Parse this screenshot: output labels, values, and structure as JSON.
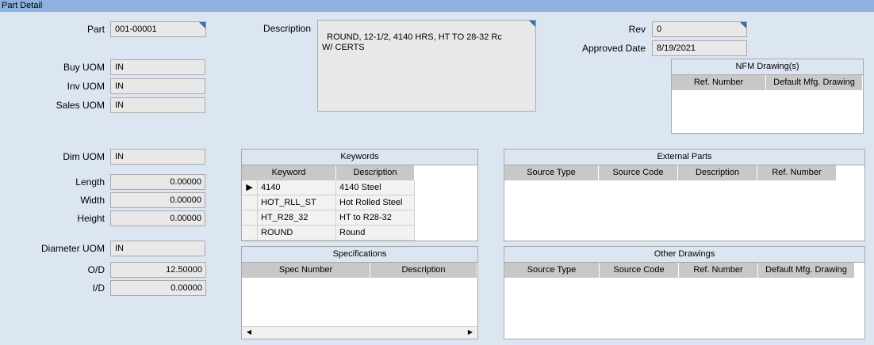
{
  "window": {
    "title": "Part Detail"
  },
  "part": {
    "label": "Part",
    "value": "001-00001"
  },
  "uom": {
    "buy_label": "Buy UOM",
    "buy_value": "IN",
    "inv_label": "Inv UOM",
    "inv_value": "IN",
    "sales_label": "Sales UOM",
    "sales_value": "IN"
  },
  "description": {
    "label": "Description",
    "value": "ROUND, 12-1/2, 4140 HRS, HT TO 28-32 Rc\nW/ CERTS"
  },
  "rev": {
    "label": "Rev",
    "value": "0"
  },
  "approved": {
    "label": "Approved Date",
    "value": "8/19/2021"
  },
  "nfm": {
    "title": "NFM Drawing(s)",
    "columns": [
      "Ref. Number",
      "Default Mfg. Drawing"
    ]
  },
  "dims": {
    "dim_uom_label": "Dim UOM",
    "dim_uom_value": "IN",
    "length_label": "Length",
    "length_value": "0.00000",
    "width_label": "Width",
    "width_value": "0.00000",
    "height_label": "Height",
    "height_value": "0.00000",
    "diameter_uom_label": "Diameter UOM",
    "diameter_uom_value": "IN",
    "od_label": "O/D",
    "od_value": "12.50000",
    "id_label": "I/D",
    "id_value": "0.00000"
  },
  "keywords": {
    "title": "Keywords",
    "columns": [
      "Keyword",
      "Description"
    ],
    "rows": [
      {
        "keyword": "4140",
        "description": "4140 Steel"
      },
      {
        "keyword": "HOT_RLL_ST",
        "description": "Hot Rolled Steel"
      },
      {
        "keyword": "HT_R28_32",
        "description": "HT to R28-32"
      },
      {
        "keyword": "ROUND",
        "description": "Round"
      }
    ]
  },
  "external_parts": {
    "title": "External Parts",
    "columns": [
      "Source Type",
      "Source Code",
      "Description",
      "Ref. Number"
    ]
  },
  "specifications": {
    "title": "Specifications",
    "columns": [
      "Spec Number",
      "Description"
    ]
  },
  "other_drawings": {
    "title": "Other Drawings",
    "columns": [
      "Source Type",
      "Source Code",
      "Ref. Number",
      "Default Mfg. Drawing"
    ]
  }
}
